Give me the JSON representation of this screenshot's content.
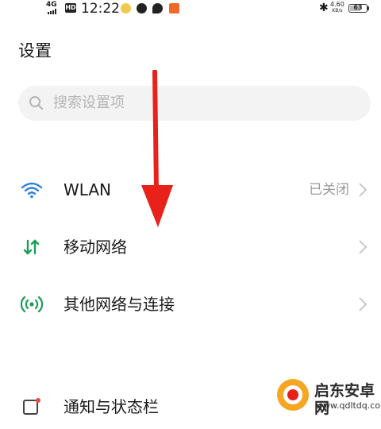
{
  "status_bar": {
    "network": "4G",
    "hd": "HD",
    "time": "12:22",
    "speed_value": "4.60",
    "speed_unit": "KB/s",
    "battery_level": "63"
  },
  "header": {
    "title": "设置"
  },
  "search": {
    "placeholder": "搜索设置项"
  },
  "settings": {
    "wlan": {
      "label": "WLAN",
      "value": "已关闭",
      "icon": "wifi-icon"
    },
    "mobile": {
      "label": "移动网络",
      "icon": "mobile-data-icon"
    },
    "other": {
      "label": "其他网络与连接",
      "icon": "connection-icon"
    },
    "notify": {
      "label": "通知与状态栏",
      "icon": "notification-icon"
    }
  },
  "annotation": {
    "arrow_color": "#e8211a"
  },
  "watermark": {
    "name": "启东安卓网",
    "url": "www.qdltdq.com"
  },
  "colors": {
    "wifi": "#2f7fe0",
    "mobile": "#1c9d56",
    "other": "#1c9d56",
    "notify_dot": "#e84b3a"
  }
}
